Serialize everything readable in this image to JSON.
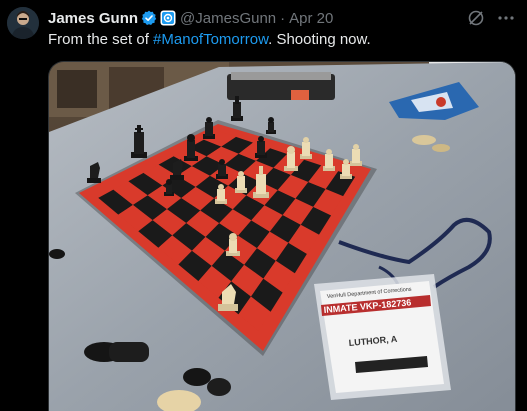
{
  "tweet": {
    "author_name": "James Gunn",
    "handle": "@JamesGunn",
    "separator": "·",
    "time": "Apr 20",
    "text_before": "From the set of ",
    "hashtag": "#ManofTomorrow",
    "text_after": ". Shooting now."
  },
  "badge_label": {
    "line1": "VenHull Department of Corrections",
    "line2": "INMATE VKP-182736",
    "line3": "LUTHOR, A"
  },
  "icons": {
    "verified": "verified-badge-icon",
    "affiliate": "affiliate-badge-icon",
    "grok": "grok-icon",
    "more": "more-icon"
  },
  "colors": {
    "background": "#000000",
    "text": "#e7e9ea",
    "muted": "#71767b",
    "link": "#1d9bf0",
    "verified": "#1d9bf0",
    "board_red": "#d93a2b",
    "board_black": "#1a1a1a",
    "table": "#9aa3ad"
  }
}
